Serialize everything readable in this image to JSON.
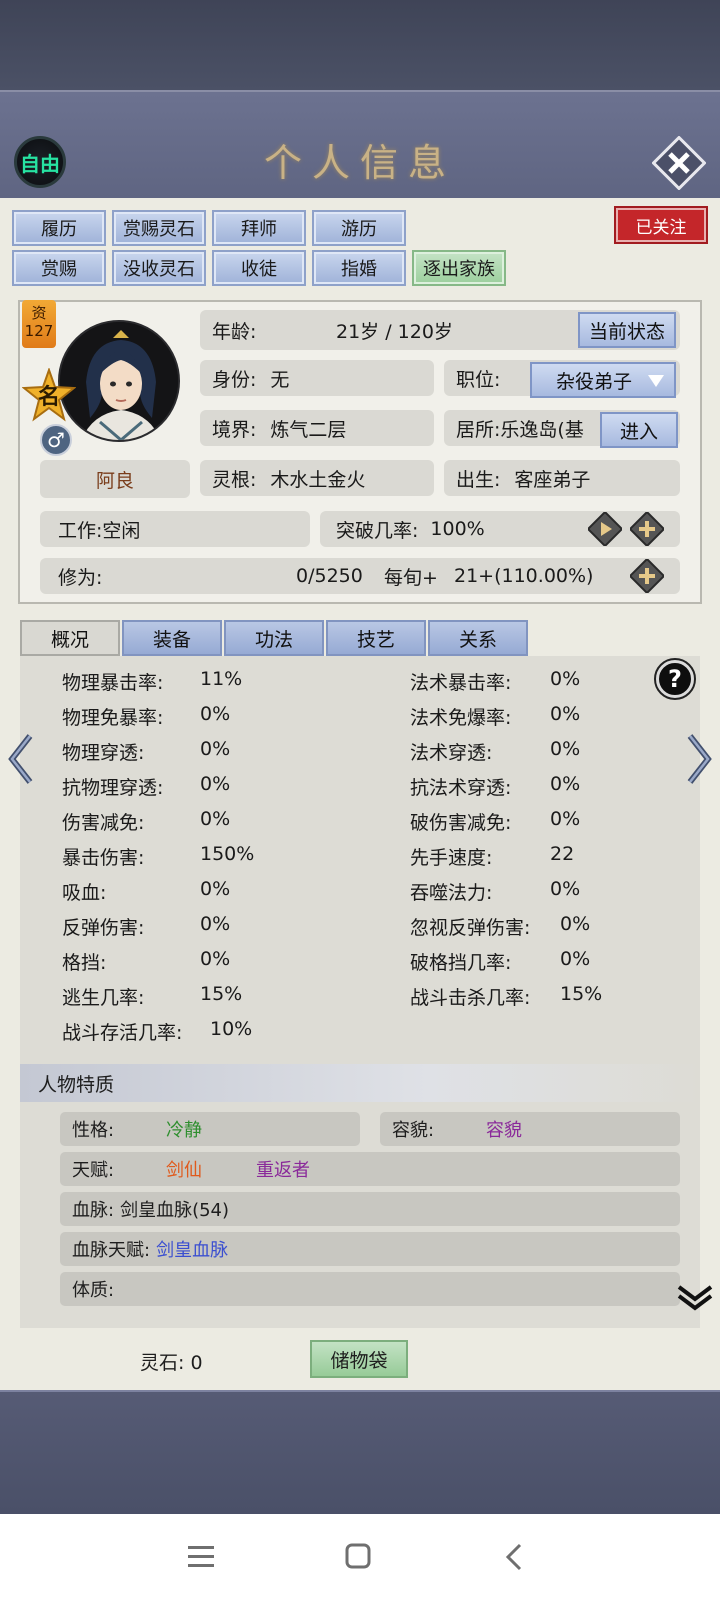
{
  "header": {
    "title": "个人信息",
    "free_label": "自由"
  },
  "top_buttons": {
    "row1": [
      "履历",
      "赏赐灵石",
      "拜师",
      "游历"
    ],
    "row2": [
      "赏赐",
      "没收灵石",
      "收徒",
      "指婚",
      "逐出家族"
    ],
    "follow": "已关注"
  },
  "character": {
    "aptitude_label": "资",
    "aptitude_value": "127",
    "fame_label": "名",
    "gender_symbol": "♂",
    "name": "阿良",
    "age_label": "年龄:",
    "age_value": "21岁 / 120岁",
    "status_button": "当前状态",
    "identity_label": "身份:",
    "identity_value": "无",
    "position_label": "职位:",
    "position_value": "杂役弟子",
    "realm_label": "境界:",
    "realm_value": "炼气二层",
    "residence_label": "居所:",
    "residence_value": "乐逸岛(基",
    "enter_button": "进入",
    "root_label": "灵根:",
    "root_value": "木水土金火",
    "birth_label": "出生:",
    "birth_value": "客座弟子",
    "work_label": "工作:",
    "work_value": "空闲",
    "breakthrough_label": "突破几率:",
    "breakthrough_value": "100%",
    "cultivation_label": "修为:",
    "cultivation_value": "0/5250",
    "per_period_label": "每旬+",
    "per_period_value": "21+(110.00%)"
  },
  "tabs": [
    "概况",
    "装备",
    "功法",
    "技艺",
    "关系"
  ],
  "stats_left": [
    {
      "label": "物理暴击率:",
      "value": "11%"
    },
    {
      "label": "物理免暴率:",
      "value": "0%"
    },
    {
      "label": "物理穿透:",
      "value": "0%"
    },
    {
      "label": "抗物理穿透:",
      "value": "0%"
    },
    {
      "label": "伤害减免:",
      "value": "0%"
    },
    {
      "label": "暴击伤害:",
      "value": "150%"
    },
    {
      "label": "吸血:",
      "value": "0%"
    },
    {
      "label": "反弹伤害:",
      "value": "0%"
    },
    {
      "label": "格挡:",
      "value": "0%"
    },
    {
      "label": "逃生几率:",
      "value": "15%"
    },
    {
      "label": "战斗存活几率:",
      "value": "10%"
    }
  ],
  "stats_right": [
    {
      "label": "法术暴击率:",
      "value": "0%"
    },
    {
      "label": "法术免爆率:",
      "value": "0%"
    },
    {
      "label": "法术穿透:",
      "value": "0%"
    },
    {
      "label": "抗法术穿透:",
      "value": "0%"
    },
    {
      "label": "破伤害减免:",
      "value": "0%"
    },
    {
      "label": "先手速度:",
      "value": "22"
    },
    {
      "label": "吞噬法力:",
      "value": "0%"
    },
    {
      "label": "忽视反弹伤害:",
      "value": "0%"
    },
    {
      "label": "破格挡几率:",
      "value": "0%"
    },
    {
      "label": "战斗击杀几率:",
      "value": "15%"
    }
  ],
  "traits": {
    "header": "人物特质",
    "personality_label": "性格:",
    "personality_value": "冷静",
    "looks_label": "容貌:",
    "looks_value": "容貌",
    "talent_label": "天赋:",
    "talent_1": "剑仙",
    "talent_2": "重返者",
    "bloodline_label": "血脉:",
    "bloodline_value": "剑皇血脉(54)",
    "bloodline_talent_label": "血脉天赋:",
    "bloodline_talent_value": "剑皇血脉",
    "physique_label": "体质:"
  },
  "footer": {
    "stones_label": "灵石: 0",
    "bag_button": "储物袋"
  },
  "colors": {
    "green": "#2f8f2f",
    "purple": "#8a2a9a",
    "orange": "#e05a1c",
    "blue": "#3b4fd0",
    "follow_red": "#c4262a"
  }
}
